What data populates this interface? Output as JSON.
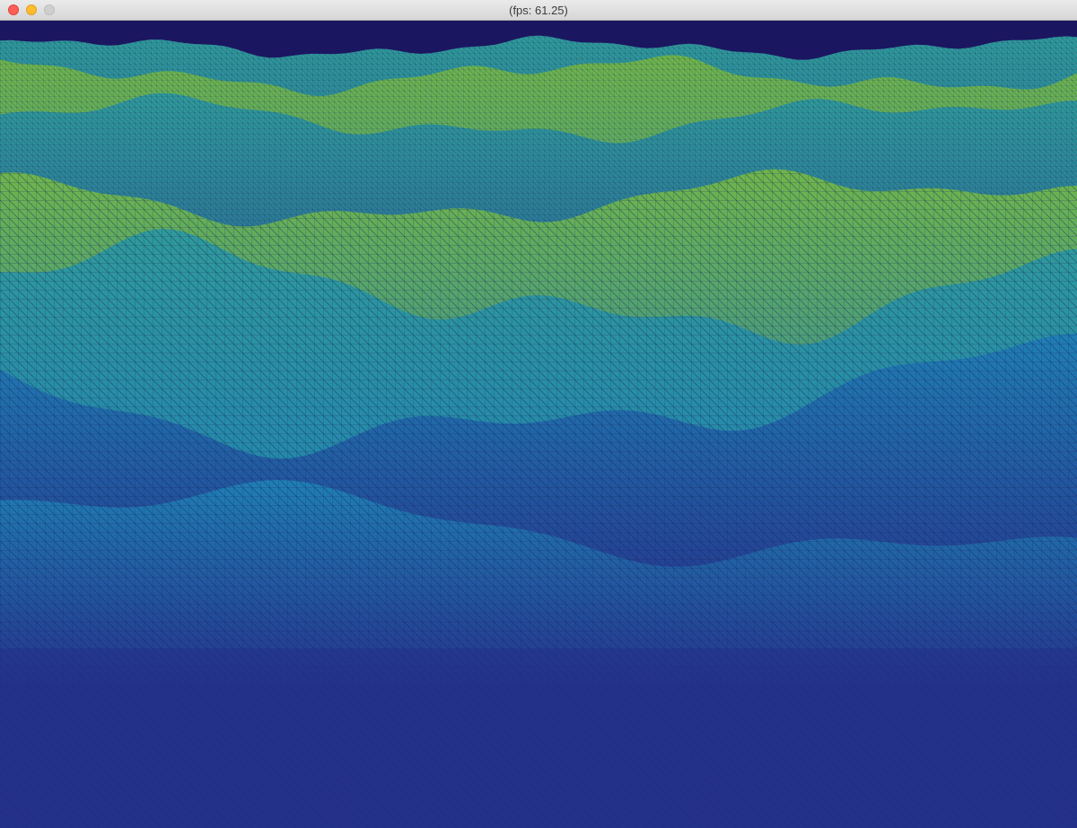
{
  "window": {
    "title": "(fps: 61.25)"
  },
  "colors": {
    "deep": "#25318a",
    "mid": "#1f7fb4",
    "high": "#2f9a9a",
    "peak": "#6fb54a",
    "sky": "#1e1a66",
    "wire": "#1a2a6a"
  },
  "icons": {
    "close": "close-icon",
    "minimize": "minimize-icon",
    "maximize": "maximize-icon"
  }
}
